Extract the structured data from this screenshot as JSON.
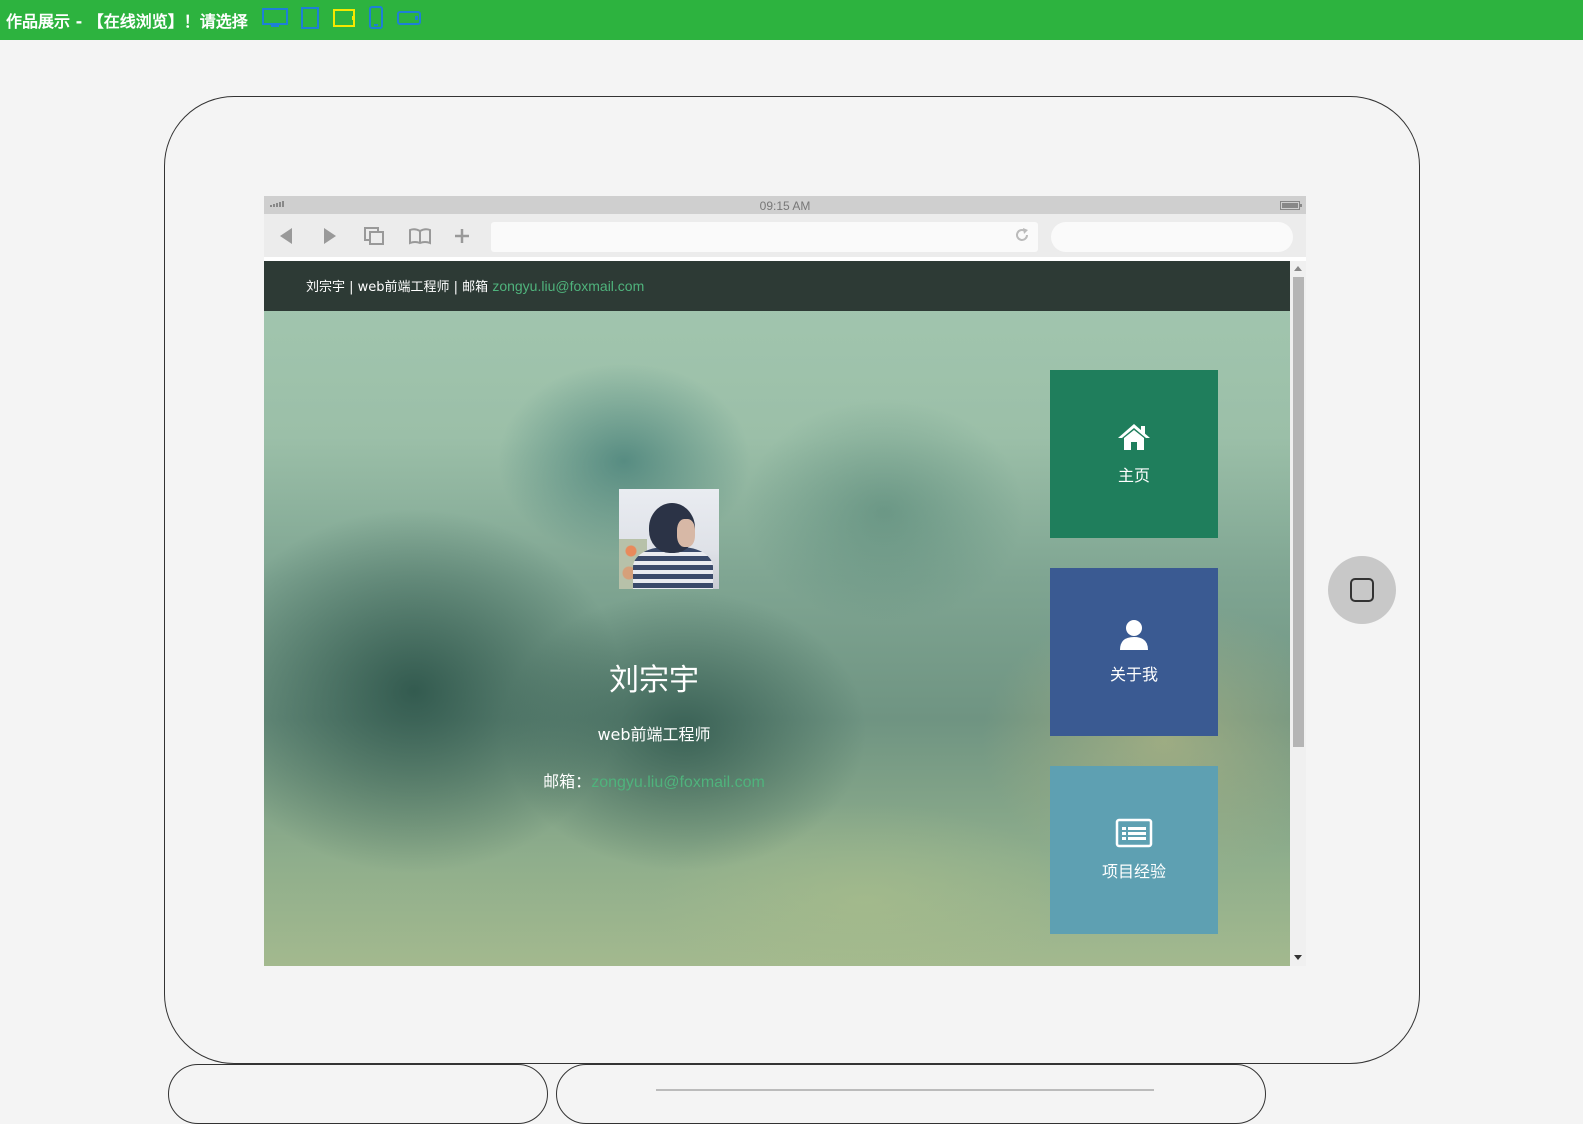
{
  "topbar": {
    "title": "作品展示 - 【在线浏览】！请选择",
    "device_icons": [
      "desktop-icon",
      "tablet-portrait-icon",
      "tablet-landscape-icon",
      "phone-portrait-icon",
      "phone-landscape-icon"
    ],
    "colors": {
      "bar": "#2db33f",
      "icon": "#1e7fd6",
      "active_icon": "#f5e800"
    }
  },
  "browser": {
    "status_time": "09:15 AM",
    "url": "",
    "search": ""
  },
  "site": {
    "nav_text": "刘宗宇 | web前端工程师 | 邮箱 ",
    "nav_email": "zongyu.liu@foxmail.com",
    "name": "刘宗宇",
    "role": "web前端工程师",
    "email_label": "邮箱：",
    "email": "zongyu.liu@foxmail.com",
    "tiles": [
      {
        "label": "主页",
        "icon": "home-icon",
        "color": "#1f7e5c"
      },
      {
        "label": "关于我",
        "icon": "user-icon",
        "color": "#3a5a92"
      },
      {
        "label": "项目经验",
        "icon": "list-icon",
        "color": "#5ea0b2"
      }
    ]
  }
}
